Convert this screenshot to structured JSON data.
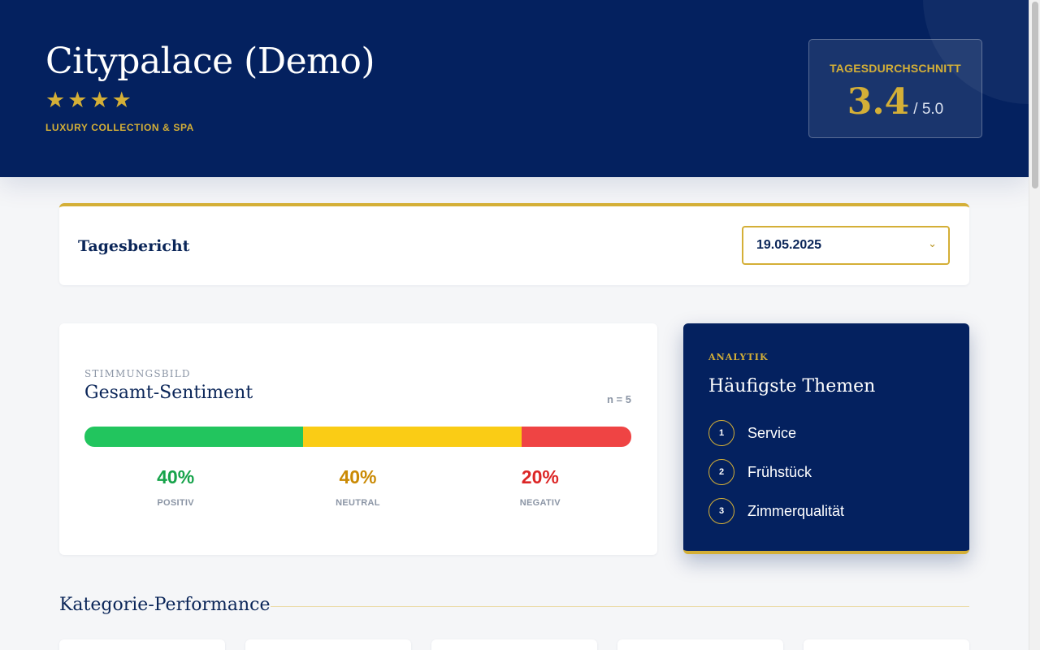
{
  "header": {
    "hotel_name": "Citypalace (Demo)",
    "stars": 4,
    "star_glyph": "★",
    "subtitle": "LUXURY COLLECTION & SPA",
    "average": {
      "label": "TAGESDURCHSCHNITT",
      "value": "3.4",
      "max": "/ 5.0"
    }
  },
  "report": {
    "title": "Tagesbericht",
    "date_select": {
      "value": "19.05.2025",
      "icon": "chevron-down-icon",
      "chevron_glyph": "⌄"
    }
  },
  "sentiment": {
    "overline": "STIMMUNGSBILD",
    "title": "Gesamt-Sentiment",
    "count": "n = 5",
    "segments": [
      {
        "key": "positive",
        "percent": 40,
        "label": "40%",
        "caption": "POSITIV",
        "bar_color": "#22c55e",
        "text_color": "#16a34a"
      },
      {
        "key": "neutral",
        "percent": 40,
        "label": "40%",
        "caption": "NEUTRAL",
        "bar_color": "#facc15",
        "text_color": "#ca8a04"
      },
      {
        "key": "negative",
        "percent": 20,
        "label": "20%",
        "caption": "NEGATIV",
        "bar_color": "#ef4444",
        "text_color": "#dc2626"
      }
    ]
  },
  "topics": {
    "overline": "ANALYTIK",
    "title": "Häufigste Themen",
    "items": [
      {
        "rank": "1",
        "label": "Service"
      },
      {
        "rank": "2",
        "label": "Frühstück"
      },
      {
        "rank": "3",
        "label": "Zimmerqualität"
      }
    ]
  },
  "categories": {
    "title": "Kategorie-Performance",
    "card_count": 5
  },
  "colors": {
    "navy": "#04215f",
    "gold": "#d4af37",
    "background": "#f5f6f8"
  }
}
